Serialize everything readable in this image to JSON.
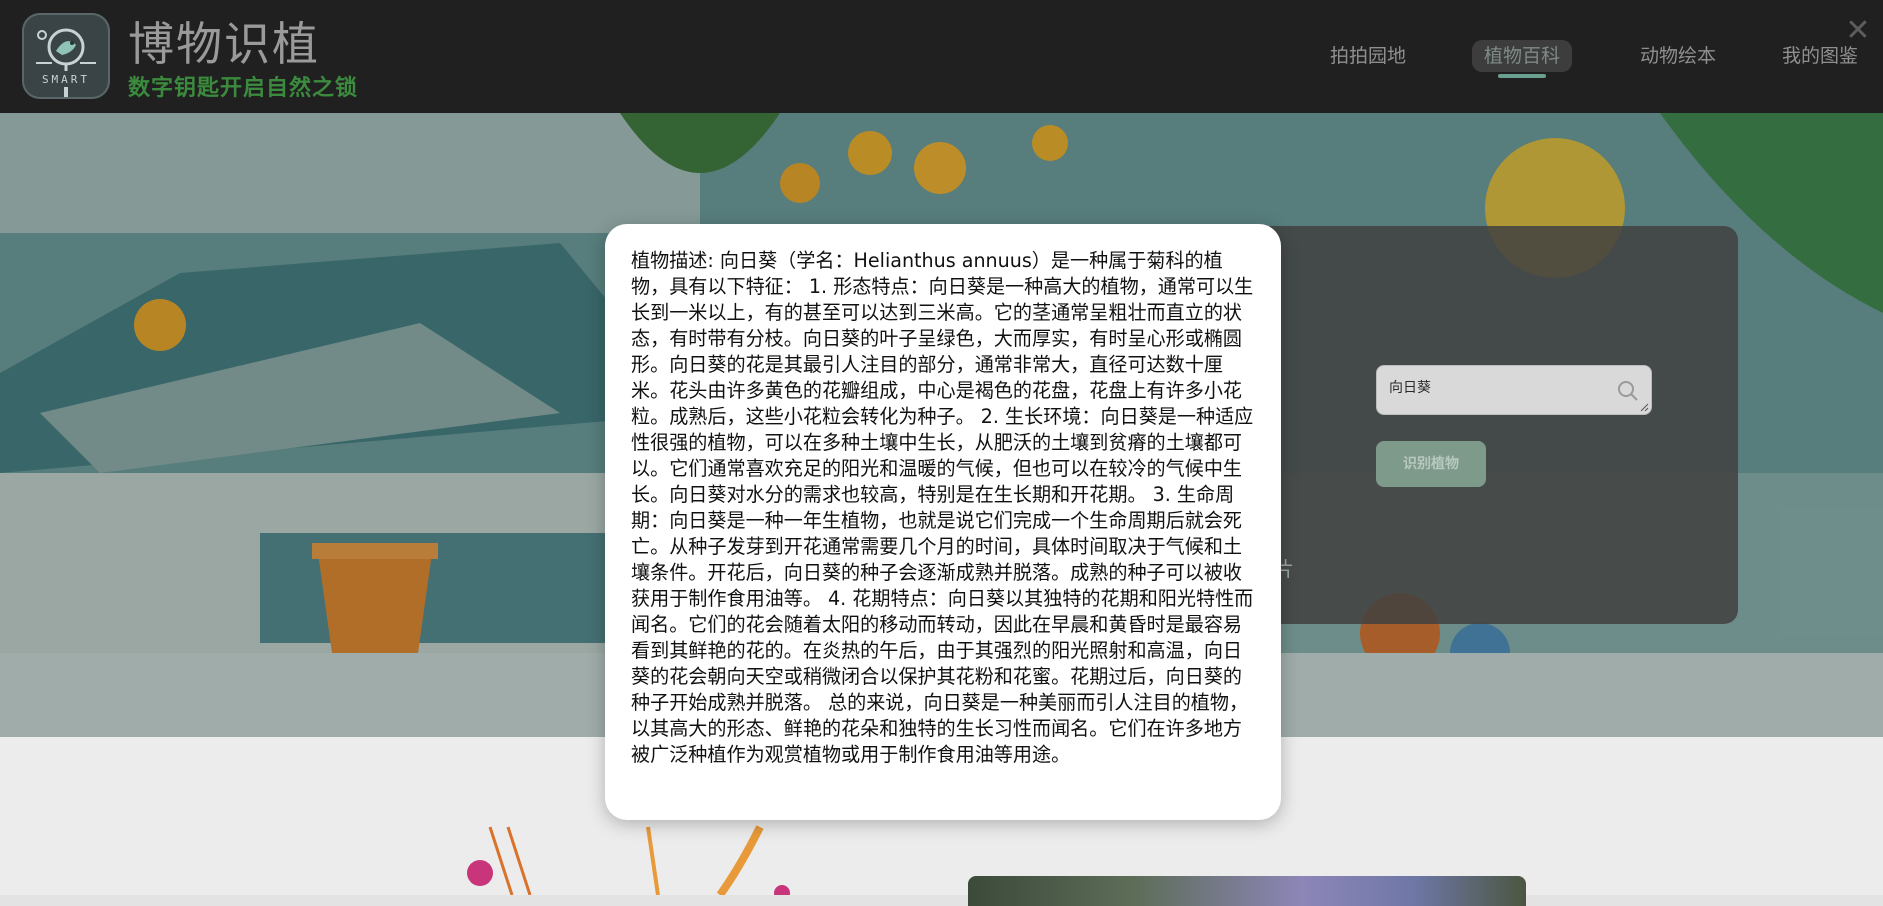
{
  "header": {
    "logo_text": "SMART",
    "site_title": "博物识植",
    "slogan": "数字钥匙开启自然之锁",
    "close_label": "✕"
  },
  "nav": {
    "items": [
      {
        "label": "拍拍园地",
        "active": false
      },
      {
        "label": "植物百科",
        "active": true
      },
      {
        "label": "动物绘本",
        "active": false
      },
      {
        "label": "我的图鉴",
        "active": false
      }
    ]
  },
  "search": {
    "value": "向日葵",
    "button_label": "识别植物",
    "hint_fragment": "片"
  },
  "modal": {
    "description": "植物描述: 向日葵（学名：Helianthus annuus）是一种属于菊科的植物，具有以下特征： 1. 形态特点：向日葵是一种高大的植物，通常可以生长到一米以上，有的甚至可以达到三米高。它的茎通常呈粗壮而直立的状态，有时带有分枝。向日葵的叶子呈绿色，大而厚实，有时呈心形或椭圆形。向日葵的花是其最引人注目的部分，通常非常大，直径可达数十厘米。花头由许多黄色的花瓣组成，中心是褐色的花盘，花盘上有许多小花粒。成熟后，这些小花粒会转化为种子。 2. 生长环境：向日葵是一种适应性很强的植物，可以在多种土壤中生长，从肥沃的土壤到贫瘠的土壤都可以。它们通常喜欢充足的阳光和温暖的气候，但也可以在较冷的气候中生长。向日葵对水分的需求也较高，特别是在生长期和开花期。 3. 生命周期：向日葵是一种一年生植物，也就是说它们完成一个生命周期后就会死亡。从种子发芽到开花通常需要几个月的时间，具体时间取决于气候和土壤条件。开花后，向日葵的种子会逐渐成熟并脱落。成熟的种子可以被收获用于制作食用油等。 4. 花期特点：向日葵以其独特的花期和阳光特性而闻名。它们的花会随着太阳的移动而转动，因此在早晨和黄昏时是最容易看到其鲜艳的花的。在炎热的午后，由于其强烈的阳光照射和高温，向日葵的花会朝向天空或稍微闭合以保护其花粉和花蜜。花期过后，向日葵的种子开始成熟并脱落。 总的来说，向日葵是一种美丽而引人注目的植物，以其高大的形态、鲜艳的花朵和独特的生长习性而闻名。它们在许多地方被广泛种植作为观赏植物或用于制作食用油等用途。"
  },
  "colors": {
    "header_bg": "#202020",
    "slogan_green": "#3b8a3e",
    "nav_underline": "#6aa08f",
    "button_bg": "#7e9a8b"
  }
}
